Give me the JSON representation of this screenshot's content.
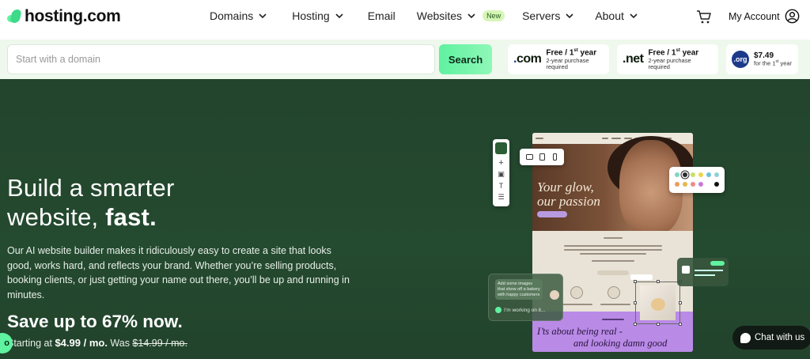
{
  "brand": {
    "name": "hosting.com",
    "colors": {
      "accent": "#5ff2a0",
      "hero_bg": "#23442d",
      "tld_blue": "#1d3a8a"
    }
  },
  "nav": {
    "items": [
      {
        "label": "Domains",
        "has_dropdown": true
      },
      {
        "label": "Hosting",
        "has_dropdown": true
      },
      {
        "label": "Email",
        "has_dropdown": false
      },
      {
        "label": "Websites",
        "has_dropdown": true,
        "badge": "New"
      },
      {
        "label": "Servers",
        "has_dropdown": true
      },
      {
        "label": "About",
        "has_dropdown": true
      }
    ],
    "cart_icon": "cart-icon",
    "account_label": "My Account",
    "account_icon": "user-circle-icon"
  },
  "search": {
    "placeholder": "Start with a domain",
    "button_label": "Search"
  },
  "tld_offers": [
    {
      "tld": ".com",
      "price_prefix": "Free / 1",
      "price_sup": "st",
      "price_suffix": " year",
      "note": "2-year purchase required"
    },
    {
      "tld": ".net",
      "price_prefix": "Free / 1",
      "price_sup": "st",
      "price_suffix": " year",
      "note": "2-year purchase required"
    },
    {
      "tld": ".org",
      "price": "$7.49",
      "note_prefix": "for the 1",
      "note_sup": "st",
      "note_suffix": " year"
    }
  ],
  "hero": {
    "title_line1": "Build a smarter",
    "title_line2_normal": "website, ",
    "title_line2_bold": "fast.",
    "description": "Our AI website builder makes it ridiculously easy to create a site that looks good, works hard, and reflects your brand. Whether you’re selling products, booking clients, or just getting your name out there, you’ll be up and running in minutes.",
    "save_text": "Save up to 67% now.",
    "start_prefix": "Starting at ",
    "start_price": "$4.99 / mo.",
    "was_label": " Was ",
    "was_price": "$14.99 / mo."
  },
  "mockup": {
    "tagline_line1": "Your glow,",
    "tagline_line2": "our passion",
    "purple_line1": "I’ts about being real -",
    "purple_line2": "and looking damn good",
    "ai_message": "Add some images that show off a bakery with happy customers",
    "ai_status": "I’m working on it...",
    "palette_colors": [
      "#7fd6c4",
      "#2b2b2b",
      "#c9e06a",
      "#f0d44a",
      "#6ac0e0",
      "#8fd0d8",
      "#f29a5a",
      "#e6b84a",
      "#f08a8a",
      "#c87ad8",
      "#111111"
    ]
  },
  "chat": {
    "label": "Chat with us"
  }
}
